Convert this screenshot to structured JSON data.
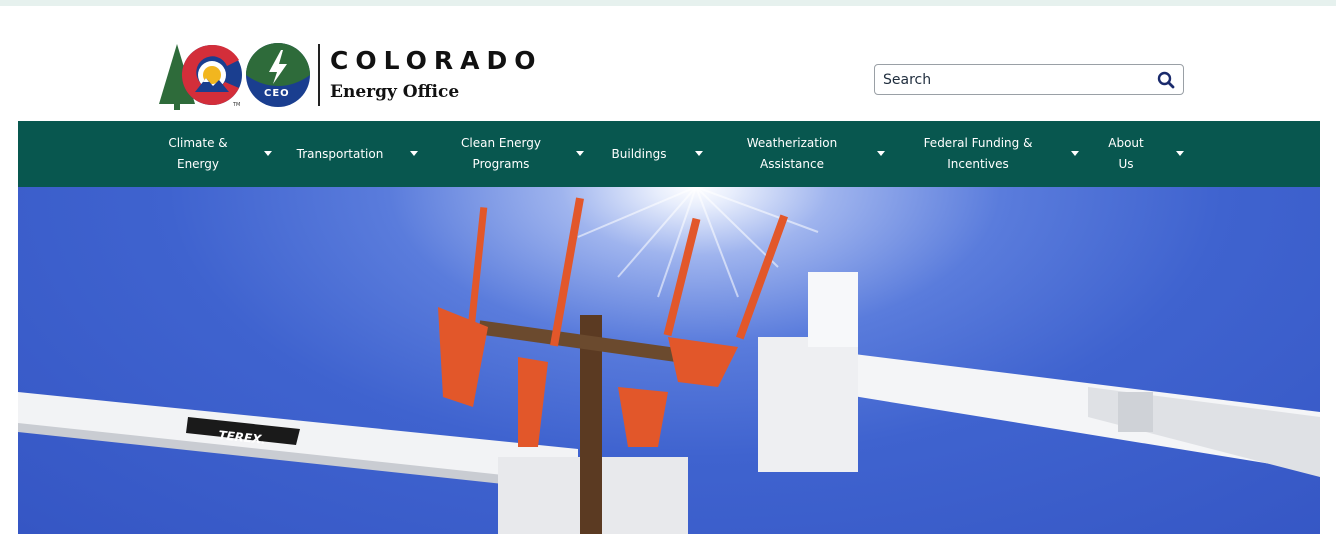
{
  "brand": {
    "title": "COLORADO",
    "subtitle": "Energy Office",
    "badge_text": "CEO",
    "colors": {
      "green": "#2e6b3a",
      "blue": "#1a3e8f",
      "red": "#d32e3a",
      "gold": "#f2b61f",
      "teal": "#08574f"
    }
  },
  "search": {
    "placeholder": "Search",
    "icon": "search-icon"
  },
  "nav": {
    "items": [
      {
        "label": "Climate &\nEnergy",
        "icon": "caret-down-icon"
      },
      {
        "label": "Transportation",
        "icon": "caret-down-icon"
      },
      {
        "label": "Clean Energy\nPrograms",
        "icon": "caret-down-icon"
      },
      {
        "label": "Buildings",
        "icon": "caret-down-icon"
      },
      {
        "label": "Weatherization\nAssistance",
        "icon": "caret-down-icon"
      },
      {
        "label": "Federal Funding &\nIncentives",
        "icon": "caret-down-icon"
      },
      {
        "label": "About\nUs",
        "icon": "caret-down-icon"
      }
    ]
  },
  "hero": {
    "truck_brand": "TEREX."
  }
}
